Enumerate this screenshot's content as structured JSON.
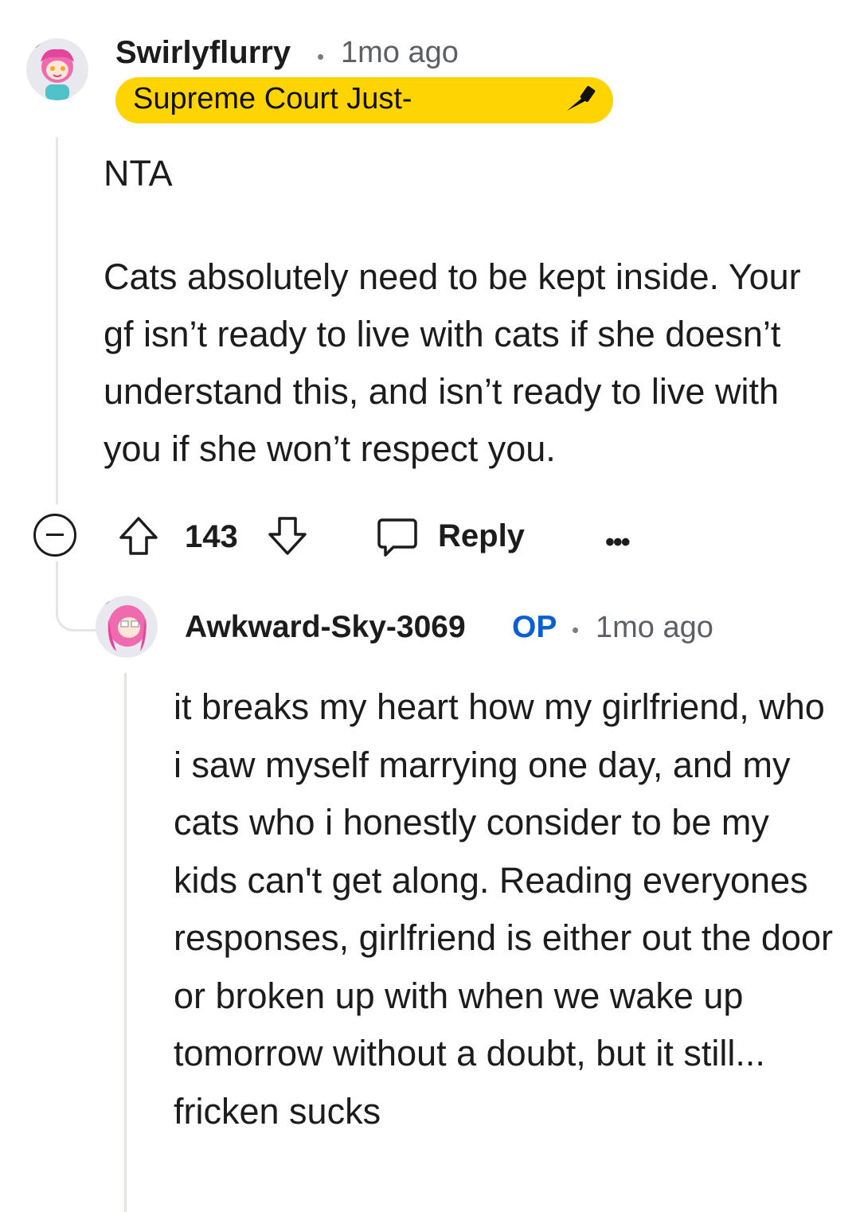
{
  "comment": {
    "username": "Swirlyflurry",
    "separator": "•",
    "timestamp": "1mo ago",
    "flair": "Supreme Court Just-",
    "body": [
      "NTA",
      "Cats absolutely need to be kept inside. Your gf isn’t ready to live with cats if she doesn’t understand this, and isn’t ready to live with you if she won’t respect you."
    ],
    "actions": {
      "vote_count": "143",
      "reply_label": "Reply",
      "more": "•••"
    }
  },
  "reply": {
    "username": "Awkward-Sky-3069",
    "op_badge": "OP",
    "separator": "•",
    "timestamp": "1mo ago",
    "body": "it breaks my heart how my girlfriend, who i saw myself marrying one day, and my cats who i honestly consider to be my kids can't get along. Reading everyones responses, girlfriend is either out the door or broken up with when we wake up tomorrow without a doubt, but it still... fricken sucks"
  },
  "colors": {
    "flair_bg": "#ffd400",
    "op_blue": "#0a5fd1",
    "thread_line": "#e3e5e8",
    "avatar_hair": "#f06ab0"
  },
  "icons": {
    "collapse": "minus-circle-icon",
    "upvote": "arrow-up-icon",
    "downvote": "arrow-down-icon",
    "reply": "speech-bubble-icon",
    "more": "ellipsis-icon"
  }
}
